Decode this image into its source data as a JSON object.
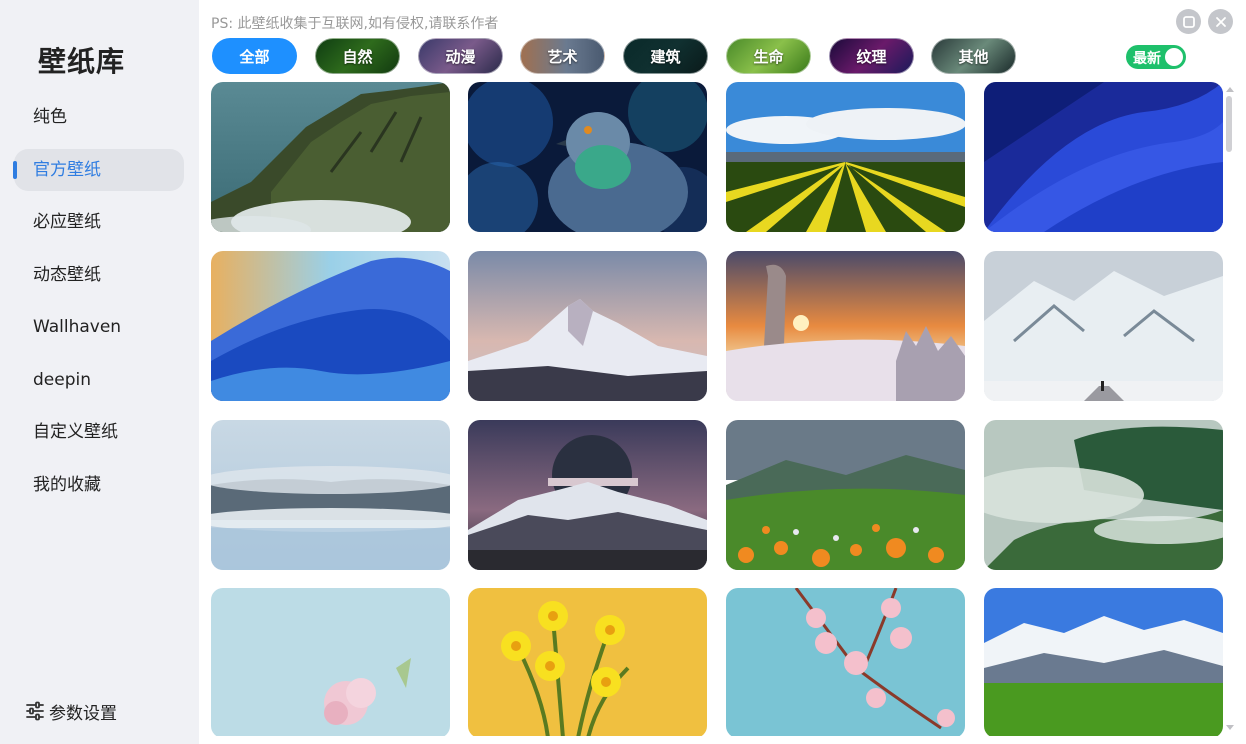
{
  "sidebar": {
    "title": "壁纸库",
    "items": [
      {
        "label": "纯色"
      },
      {
        "label": "官方壁纸",
        "active": true
      },
      {
        "label": "必应壁纸"
      },
      {
        "label": "动态壁纸"
      },
      {
        "label": "Wallhaven"
      },
      {
        "label": "deepin"
      },
      {
        "label": "自定义壁纸"
      },
      {
        "label": "我的收藏"
      }
    ],
    "settings_label": "参数设置",
    "settings_icon": "sliders-icon"
  },
  "header": {
    "notice": "PS: 此壁纸收集于互联网,如有侵权,请联系作者",
    "window_buttons": [
      "maximize-icon",
      "close-icon"
    ]
  },
  "categories": [
    {
      "label": "全部",
      "active": true
    },
    {
      "label": "自然"
    },
    {
      "label": "动漫"
    },
    {
      "label": "艺术"
    },
    {
      "label": "建筑"
    },
    {
      "label": "生命"
    },
    {
      "label": "纹理"
    },
    {
      "label": "其他"
    }
  ],
  "sort_toggle": {
    "label": "最新",
    "on": true
  },
  "wallpapers": [
    {
      "subject": "coastal cliffs"
    },
    {
      "subject": "pigeon"
    },
    {
      "subject": "tulip fields"
    },
    {
      "subject": "blue abstract wave"
    },
    {
      "subject": "blue glass wave"
    },
    {
      "subject": "snowy peak"
    },
    {
      "subject": "snow sunset"
    },
    {
      "subject": "snowy valley"
    },
    {
      "subject": "misty forest"
    },
    {
      "subject": "mountain moon"
    },
    {
      "subject": "flower meadow"
    },
    {
      "subject": "foggy hills"
    },
    {
      "subject": "pink flower"
    },
    {
      "subject": "daffodils"
    },
    {
      "subject": "cherry blossoms"
    },
    {
      "subject": "alpine pasture"
    }
  ],
  "colors": {
    "accent": "#1e90ff",
    "nav_active": "#2f7de1",
    "toggle_on": "#1ec06b",
    "sidebar_bg": "#f0f1f5"
  }
}
